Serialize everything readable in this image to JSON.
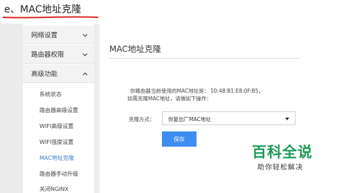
{
  "doc_heading": "e、MAC地址克隆",
  "sidebar": {
    "menus": [
      {
        "label": "网络设置",
        "icon": "chevron-down-icon"
      },
      {
        "label": "路由器权限",
        "icon": "chevron-down-icon"
      },
      {
        "label": "高级功能",
        "icon": "chevron-up-icon"
      }
    ],
    "sub_items": [
      {
        "label": "系统状态",
        "active": false
      },
      {
        "label": "路由器高级设置",
        "active": false
      },
      {
        "label": "WIFI高级设置",
        "active": false
      },
      {
        "label": "WIFI强度设置",
        "active": false
      },
      {
        "label": "MAC地址克隆",
        "active": true
      },
      {
        "label": "路由器手动升级",
        "active": false
      },
      {
        "label": "关闭NGINX",
        "active": false
      }
    ]
  },
  "content": {
    "title": "MAC地址克隆",
    "current_mac_label": "你路由器当前使用的MAC地址是：",
    "current_mac_value": "10:48:B1:E8:0F:B5，",
    "hint": "如需克隆MAC地址，请做如下操作：",
    "clone_mode_label": "克隆方式：",
    "clone_mode_value": "你复出厂MAC地址",
    "save_label": "保存"
  },
  "watermark": {
    "main": "百科全说",
    "sub": "助你轻松解决"
  },
  "colors": {
    "accent": "#3d8ef0",
    "active_link": "#3a7bd5",
    "annotation_underline": "#d9231c",
    "watermark": "#1b9a56"
  }
}
